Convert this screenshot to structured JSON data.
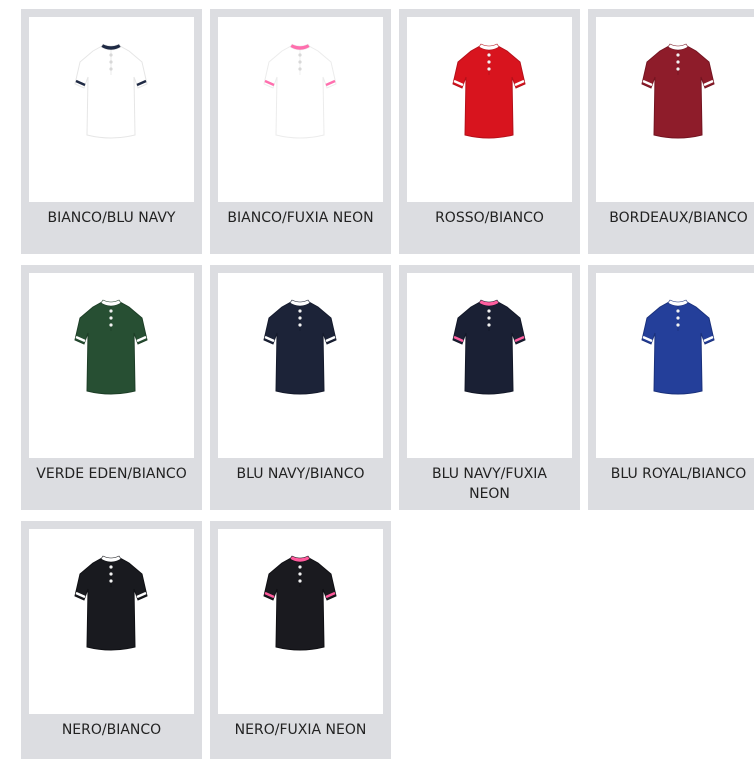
{
  "products": [
    {
      "label": "BIANCO/BLU NAVY",
      "color": "#ffffff",
      "tip": "#1f2a44",
      "stroke": "#e6e6e6"
    },
    {
      "label": "BIANCO/FUXIA NEON",
      "color": "#ffffff",
      "tip": "#ff6fae",
      "stroke": "#ececec"
    },
    {
      "label": "ROSSO/BIANCO",
      "color": "#d8141e",
      "tip": "#ffffff",
      "stroke": "#b5101a"
    },
    {
      "label": "BORDEAUX/BIANCO",
      "color": "#8e1c2a",
      "tip": "#ffffff",
      "stroke": "#741421"
    },
    {
      "label": "VERDE EDEN/BIANCO",
      "color": "#274f33",
      "tip": "#ffffff",
      "stroke": "#1d3e27"
    },
    {
      "label": "BLU NAVY/BIANCO",
      "color": "#1c2338",
      "tip": "#ffffff",
      "stroke": "#141a2c"
    },
    {
      "label": "BLU NAVY/FUXIA NEON",
      "color": "#1a2034",
      "tip": "#ff5fa0",
      "stroke": "#121727"
    },
    {
      "label": "BLU ROYAL/BIANCO",
      "color": "#243f9a",
      "tip": "#ffffff",
      "stroke": "#1a317c"
    },
    {
      "label": "NERO/BIANCO",
      "color": "#191a1f",
      "tip": "#ffffff",
      "stroke": "#0f1014"
    },
    {
      "label": "NERO/FUXIA NEON",
      "color": "#1a1a1f",
      "tip": "#ff5a9c",
      "stroke": "#0f0f13"
    }
  ]
}
